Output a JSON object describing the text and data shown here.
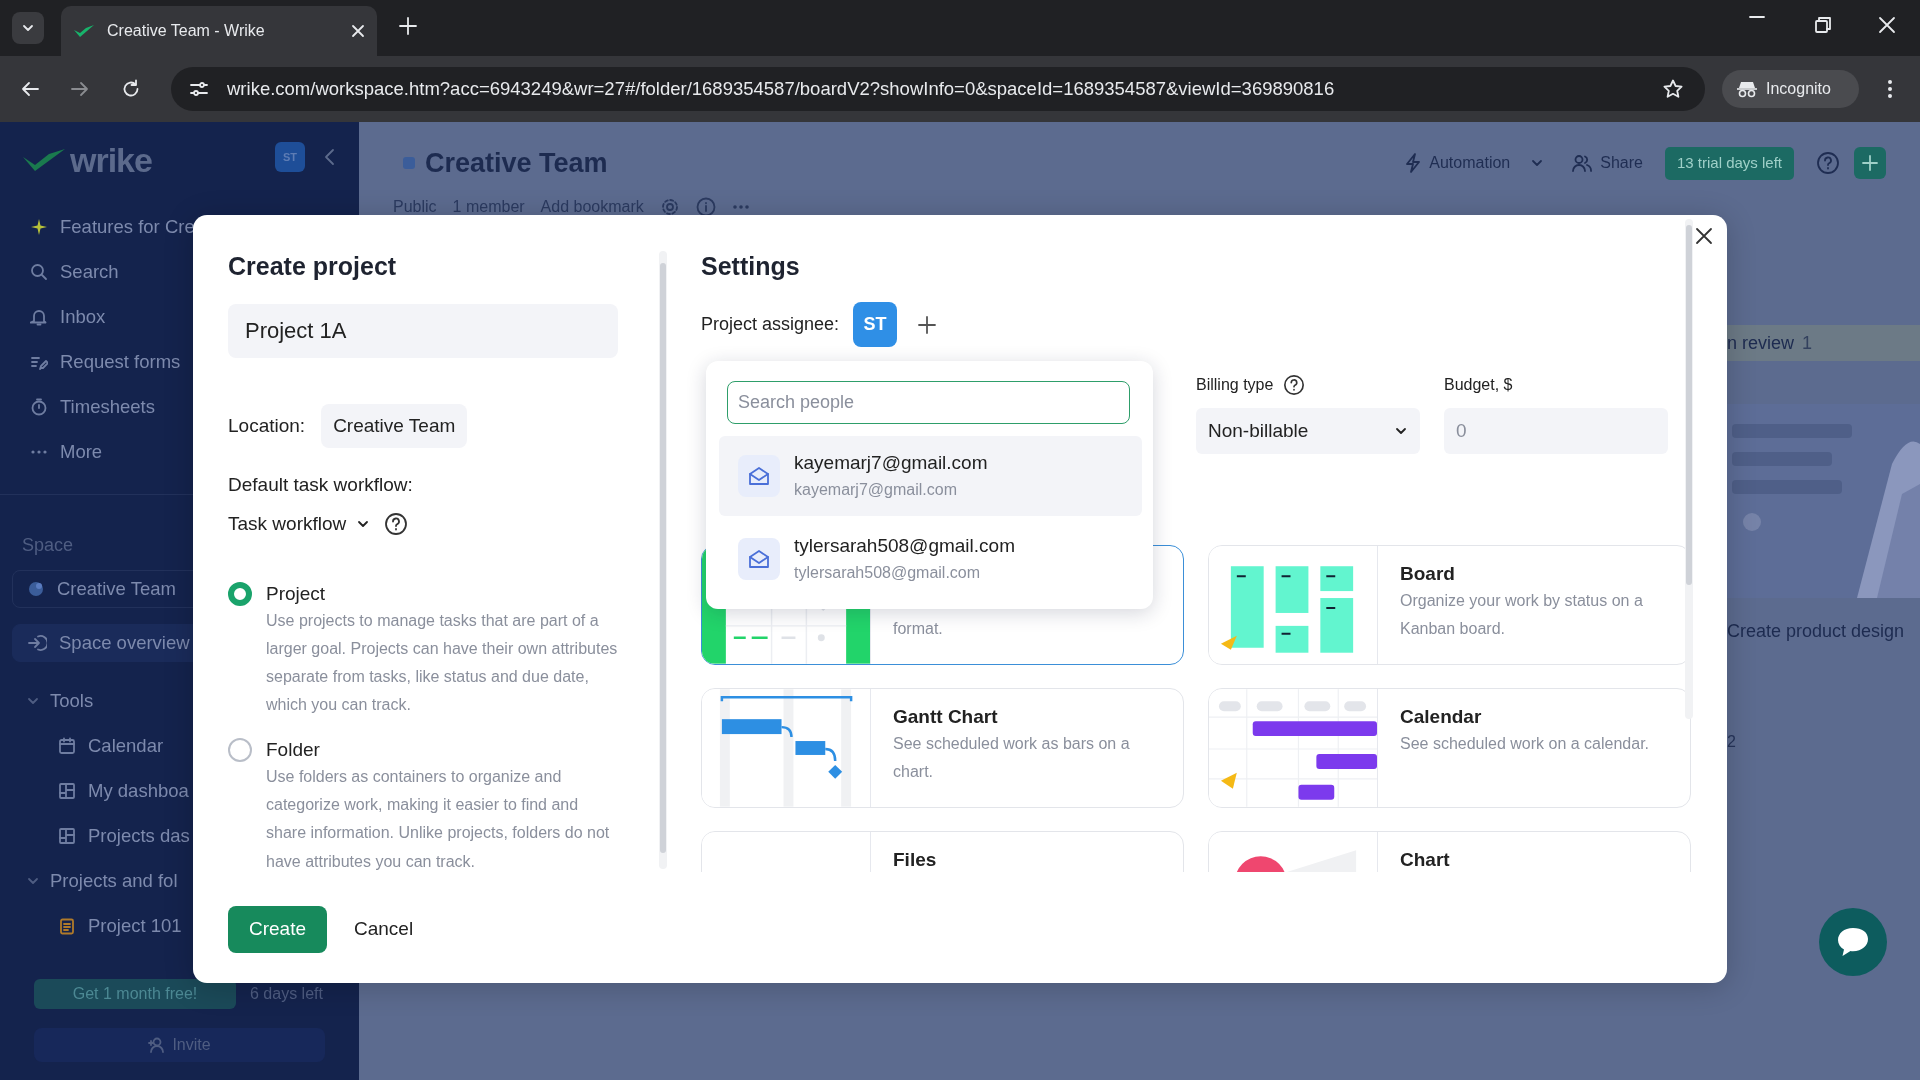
{
  "browser": {
    "tab_title": "Creative Team - Wrike",
    "url": "wrike.com/workspace.htm?acc=6943249&wr=27#/folder/1689354587/boardV2?showInfo=0&spaceId=1689354587&viewId=369890816",
    "profile": "Incognito"
  },
  "sidebar": {
    "logo": "wrike",
    "badge": "ST",
    "nav": [
      {
        "label": "Features for Cre",
        "kind": "features"
      },
      {
        "label": "Search",
        "kind": "search"
      },
      {
        "label": "Inbox",
        "kind": "inbox"
      },
      {
        "label": "Request forms",
        "kind": "forms"
      },
      {
        "label": "Timesheets",
        "kind": "timesheets"
      },
      {
        "label": "More",
        "kind": "more"
      }
    ],
    "section": "Space",
    "space_items": [
      {
        "label": "Creative Team",
        "kind": "space",
        "selected": false
      },
      {
        "label": "Space overview",
        "kind": "overview",
        "selected": true
      }
    ],
    "tree": [
      {
        "label": "Tools",
        "expanded": true,
        "children": [
          {
            "label": "Calendar",
            "kind": "calendar"
          },
          {
            "label": "My dashboa",
            "kind": "dashboard"
          },
          {
            "label": "Projects das",
            "kind": "dashboard"
          }
        ]
      },
      {
        "label": "Projects and fol",
        "expanded": true,
        "children": [
          {
            "label": "Project 101",
            "kind": "project"
          }
        ]
      }
    ],
    "promo": "Get 1 month free!",
    "promo_note": "6 days left",
    "invite": "Invite"
  },
  "header": {
    "title": "Creative Team",
    "meta": [
      "Public",
      "1 member",
      "Add bookmark"
    ],
    "automation": "Automation",
    "share": "Share",
    "trial": "13 trial days left"
  },
  "board": {
    "column_title": "n review",
    "column_count": "1",
    "card": {
      "kind": "picture",
      "title": "Create product design",
      "count": "2"
    }
  },
  "modal": {
    "title": "Create project",
    "name": "Project 1A",
    "location_label": "Location:",
    "location": "Creative Team",
    "workflow_label": "Default task workflow:",
    "workflow": "Task workflow",
    "types": [
      {
        "label": "Project",
        "description": "Use projects to manage tasks that are part of a larger goal. Projects can have their own attributes separate from tasks, like status and due date, which you can track.",
        "selected": true
      },
      {
        "label": "Folder",
        "description": "Use folders as containers to organize and categorize work, making it easier to find and share information. Unlike projects, folders do not have attributes you can track.",
        "selected": false
      }
    ],
    "create": "Create",
    "cancel": "Cancel",
    "settings": {
      "title": "Settings",
      "assignee_label": "Project assignee:",
      "assignee": "ST",
      "billing_label": "Billing type",
      "billing_value": "Non-billable",
      "budget_label": "Budget, $",
      "budget_value": "0",
      "covered_view": {
        "kind": "table",
        "description": "format.",
        "selected": true
      },
      "views": [
        {
          "kind": "board",
          "title": "Board",
          "description": "Organize your work by status on a Kanban board.",
          "selected": false
        },
        {
          "kind": "gantt",
          "title": "Gantt Chart",
          "description": "See scheduled work as bars on a chart.",
          "selected": false
        },
        {
          "kind": "calendar",
          "title": "Calendar",
          "description": "See scheduled work on a calendar.",
          "selected": false
        },
        {
          "kind": "files",
          "title": "Files",
          "selected": false
        },
        {
          "kind": "chart",
          "title": "Chart",
          "selected": false
        }
      ]
    },
    "people": {
      "placeholder": "Search people",
      "results": [
        {
          "name": "kayemarj7@gmail.com",
          "email": "kayemarj7@gmail.com",
          "selected": true
        },
        {
          "name": "tylersarah508@gmail.com",
          "email": "tylersarah508@gmail.com",
          "selected": false
        }
      ]
    }
  }
}
